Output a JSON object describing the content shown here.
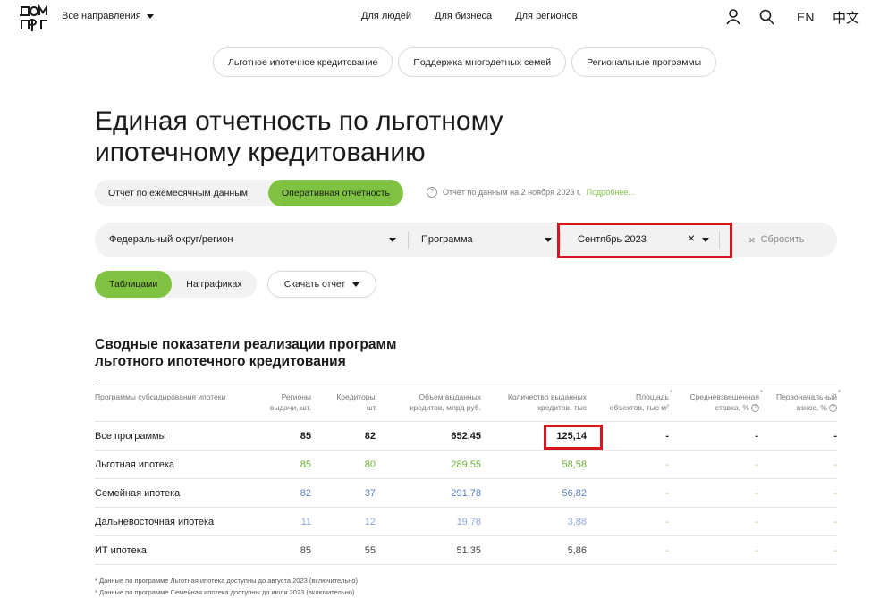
{
  "header": {
    "directions_label": "Все направления",
    "nav": [
      "Для людей",
      "Для бизнеса",
      "Для регионов"
    ],
    "lang_en": "EN",
    "lang_zh": "中文"
  },
  "pills": [
    "Льготное ипотечное кредитование",
    "Поддержка многодетных семей",
    "Региональные программы"
  ],
  "title": "Единая отчетность по льготному ипотечному кредитованию",
  "report_toggle": {
    "monthly": "Отчет по ежемесячным данным",
    "operational": "Оперативная отчетность"
  },
  "info": {
    "text": "Отчёт по данным на 2 ноября 2023 г.",
    "more": "Подробнее..."
  },
  "filters": {
    "region": "Федеральный округ/регион",
    "program": "Программа",
    "period": "Сентябрь 2023",
    "reset": "Сбросить"
  },
  "view": {
    "tables": "Таблицами",
    "charts": "На графиках",
    "download": "Скачать отчет"
  },
  "section_title": "Сводные показатели реализации программ льготного ипотечного кредитования",
  "table": {
    "headers": [
      "Программы субсидирования ипотеки",
      "Регионы выдачи, шт.",
      "Кредиторы, шт.",
      "Объем выданных кредитов, млрд руб.",
      "Количество выданных кредитов, тыс",
      "Площадь объектов, тыс м²",
      "Средневзвешенная ставка, %",
      "Первоначальный взнос, %"
    ],
    "rows": [
      {
        "name": "Все программы",
        "regions": "85",
        "lenders": "82",
        "volume": "652,45",
        "count": "125,14",
        "area": "-",
        "rate": "-",
        "down": "-"
      },
      {
        "name": "Льготная ипотека",
        "regions": "85",
        "lenders": "80",
        "volume": "289,55",
        "count": "58,58",
        "area": "-",
        "rate": "-",
        "down": "-"
      },
      {
        "name": "Семейная ипотека",
        "regions": "82",
        "lenders": "37",
        "volume": "291,78",
        "count": "56,82",
        "area": "-",
        "rate": "-",
        "down": "-"
      },
      {
        "name": "Дальневосточная ипотека",
        "regions": "11",
        "lenders": "12",
        "volume": "19,78",
        "count": "3,88",
        "area": "-",
        "rate": "-",
        "down": "-"
      },
      {
        "name": "ИТ ипотека",
        "regions": "85",
        "lenders": "55",
        "volume": "51,35",
        "count": "5,86",
        "area": "-",
        "rate": "-",
        "down": "-"
      }
    ]
  },
  "notes": [
    "* Данные по программе Льготная ипотека доступны до августа 2023 (включительно)",
    "* Данные по программе Семейная ипотека доступны до июля 2023 (включительно)"
  ],
  "colors": {
    "accent_green": "#7fc241",
    "highlight_red": "#d6151e",
    "family_blue": "#5b7fc4"
  }
}
